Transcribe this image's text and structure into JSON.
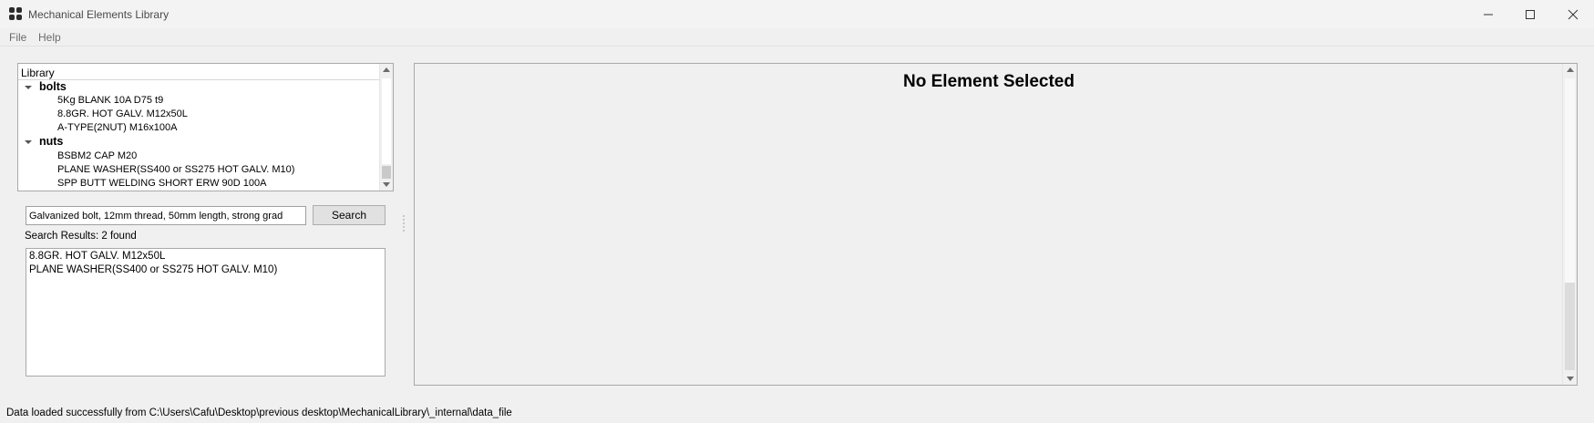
{
  "window": {
    "title": "Mechanical Elements Library",
    "app_icon": "app-grid-icon"
  },
  "menu": {
    "items": [
      "File",
      "Help"
    ]
  },
  "library": {
    "header": "Library",
    "groups": [
      {
        "name": "bolts",
        "expanded": true,
        "items": [
          "5Kg BLANK 10A D75 t9",
          "8.8GR. HOT GALV. M12x50L",
          "A-TYPE(2NUT) M16x100A"
        ]
      },
      {
        "name": "nuts",
        "expanded": true,
        "items": [
          "BSBM2 CAP M20",
          "PLANE WASHER(SS400 or SS275 HOT GALV. M10)",
          "SPP BUTT WELDING SHORT ERW 90D 100A"
        ]
      }
    ]
  },
  "search": {
    "value": "Galvanized bolt, 12mm thread, 50mm length, strong grad",
    "button_label": "Search"
  },
  "results": {
    "label": "Search Results: 2 found",
    "items": [
      "8.8GR. HOT GALV. M12x50L",
      "PLANE WASHER(SS400 or SS275 HOT GALV. M10)"
    ]
  },
  "detail": {
    "title": "No Element Selected"
  },
  "status": {
    "text": "Data loaded successfully from C:\\Users\\Cafu\\Desktop\\previous desktop\\MechanicalLibrary\\_internal\\data_file"
  },
  "colors": {
    "window_bg": "#f0f0f0",
    "titlebar_bg": "#f3f3f3",
    "border": "#a9a9a9",
    "menu_text": "#6b6b6b"
  }
}
